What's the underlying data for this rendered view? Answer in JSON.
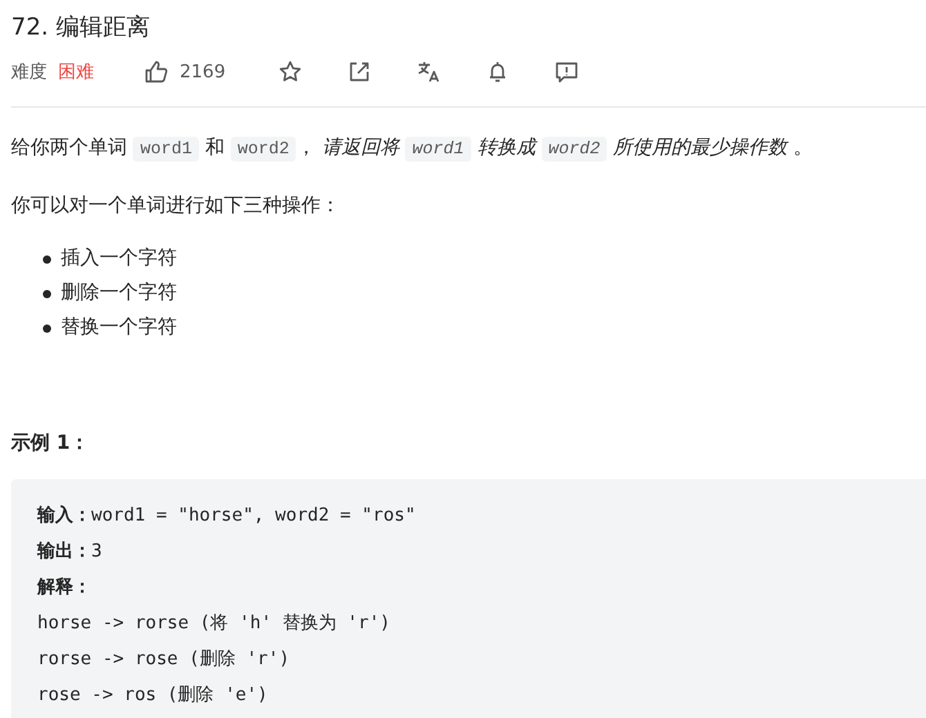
{
  "title": "72. 编辑距离",
  "meta": {
    "difficulty_label": "难度",
    "difficulty": "困难",
    "likes": "2169"
  },
  "description": [
    {
      "kind": "plain",
      "text": "给你两个单词 "
    },
    {
      "kind": "code",
      "text": "word1"
    },
    {
      "kind": "plain",
      "text": " 和 "
    },
    {
      "kind": "code",
      "text": "word2"
    },
    {
      "kind": "plain",
      "text": "， "
    },
    {
      "kind": "emphasis",
      "text": "请返回将 "
    },
    {
      "kind": "emphasis-code",
      "text": "word1"
    },
    {
      "kind": "emphasis",
      "text": " 转换成 "
    },
    {
      "kind": "emphasis-code",
      "text": "word2"
    },
    {
      "kind": "emphasis",
      "text": " 所使用的最少操作数"
    },
    {
      "kind": "plain",
      "text": " 。"
    }
  ],
  "operations_intro": "你可以对一个单词进行如下三种操作：",
  "operations": [
    "插入一个字符",
    "删除一个字符",
    "替换一个字符"
  ],
  "example_title": "示例 1：",
  "example_lines": [
    "**输入：**word1 = \"horse\", word2 = \"ros\"",
    "**输出：**3",
    "**解释：**",
    "horse -> rorse (将 'h' 替换为 'r')",
    "rorse -> rose (删除 'r')",
    "rose -> ros (删除 'e')"
  ]
}
